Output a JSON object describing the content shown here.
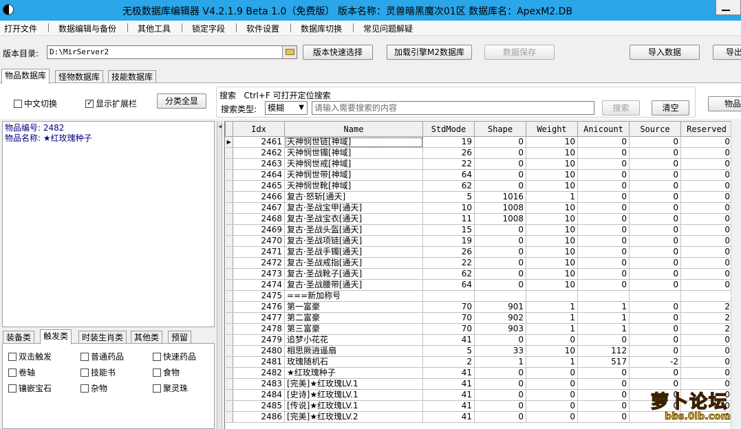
{
  "window": {
    "title": "无极数据库编辑器 V4.2.1.9    Beta 1.0（免费版）    版本名称：灵兽暗黑魔次01区    数据库名：ApexM2.DB"
  },
  "menu": [
    "打开文件",
    "数据编辑与备份",
    "其他工具",
    "锁定字段",
    "软件设置",
    "数据库切换",
    "常见问题解疑"
  ],
  "toolbar": {
    "dir_label": "版本目录:",
    "dir_value": "D:\\MirServer2",
    "quick_select": "版本快速选择",
    "load_engine": "加载引擎M2数据库",
    "save_data": "数据保存",
    "import_data": "导入数据",
    "export_data": "导出"
  },
  "main_tabs": [
    "物品数据库",
    "怪物数据库",
    "技能数据库"
  ],
  "filter": {
    "chinese_switch": "中文切换",
    "show_ext": "显示扩展栏",
    "show_all": "分类全显",
    "search_title": "搜索   Ctrl+F 可打开定位搜索",
    "search_type_label": "搜索类型:",
    "search_type_value": "模糊",
    "search_placeholder": "请输入需要搜索的内容",
    "search_button": "搜索",
    "clear_button": "清空",
    "right_button": "物品"
  },
  "info": {
    "item_id": "物品编号: 2482",
    "item_name": "物品名称: ★红玫瑰种子"
  },
  "category_tabs": [
    "装备类",
    "触发类",
    "时装生肖类",
    "其他类",
    "预留"
  ],
  "category_checks": [
    [
      "双击触发",
      "普通药品",
      "快速药品"
    ],
    [
      "卷轴",
      "技能书",
      "食物"
    ],
    [
      "镶嵌宝石",
      "杂物",
      "聚灵珠"
    ]
  ],
  "grid": {
    "columns": [
      "Idx",
      "Name",
      "StdMode",
      "Shape",
      "Weight",
      "Anicount",
      "Source",
      "Reserved"
    ],
    "rows": [
      [
        "2461",
        "天神悯世链[神域]",
        "19",
        "0",
        "10",
        "0",
        "0",
        "0"
      ],
      [
        "2462",
        "天神悯世镯[神域]",
        "26",
        "0",
        "10",
        "0",
        "0",
        "0"
      ],
      [
        "2463",
        "天神悯世戒[神域]",
        "22",
        "0",
        "10",
        "0",
        "0",
        "0"
      ],
      [
        "2464",
        "天神悯世带[神域]",
        "64",
        "0",
        "10",
        "0",
        "0",
        "0"
      ],
      [
        "2465",
        "天神悯世靴[神域]",
        "62",
        "0",
        "10",
        "0",
        "0",
        "0"
      ],
      [
        "2466",
        "复古·怒斩[通天]",
        "5",
        "1016",
        "1",
        "0",
        "0",
        "0"
      ],
      [
        "2467",
        "复古·圣战宝甲[通天]",
        "10",
        "1008",
        "10",
        "0",
        "0",
        "0"
      ],
      [
        "2468",
        "复古·圣战宝衣[通天]",
        "11",
        "1008",
        "10",
        "0",
        "0",
        "0"
      ],
      [
        "2469",
        "复古·圣战头盔[通天]",
        "15",
        "0",
        "10",
        "0",
        "0",
        "0"
      ],
      [
        "2470",
        "复古·圣战项链[通天]",
        "19",
        "0",
        "10",
        "0",
        "0",
        "0"
      ],
      [
        "2471",
        "复古·圣战手镯[通天]",
        "26",
        "0",
        "10",
        "0",
        "0",
        "0"
      ],
      [
        "2472",
        "复古·圣战戒指[通天]",
        "22",
        "0",
        "10",
        "0",
        "0",
        "0"
      ],
      [
        "2473",
        "复古·圣战靴子[通天]",
        "62",
        "0",
        "10",
        "0",
        "0",
        "0"
      ],
      [
        "2474",
        "复古·圣战腰带[通天]",
        "64",
        "0",
        "10",
        "0",
        "0",
        "0"
      ],
      [
        "2475",
        "===新加称号",
        "",
        "",
        "",
        "",
        "",
        ""
      ],
      [
        "2476",
        "第一富豪",
        "70",
        "901",
        "1",
        "1",
        "0",
        "2"
      ],
      [
        "2477",
        "第二富豪",
        "70",
        "902",
        "1",
        "1",
        "0",
        "2"
      ],
      [
        "2478",
        "第三富豪",
        "70",
        "903",
        "1",
        "1",
        "0",
        "2"
      ],
      [
        "2479",
        "追梦小花花",
        "41",
        "0",
        "0",
        "0",
        "0",
        "0"
      ],
      [
        "2480",
        "相思厥逍遥扇",
        "5",
        "33",
        "10",
        "112",
        "0",
        "0"
      ],
      [
        "2481",
        "玫瑰随机石",
        "2",
        "1",
        "1",
        "517",
        "-2",
        "0"
      ],
      [
        "2482",
        "★红玫瑰种子",
        "41",
        "0",
        "0",
        "0",
        "0",
        "0"
      ],
      [
        "2483",
        "[完美]★红玫瑰LV.1",
        "41",
        "0",
        "0",
        "0",
        "0",
        "0"
      ],
      [
        "2484",
        "[史诗]★红玫瑰LV.1",
        "41",
        "0",
        "0",
        "0",
        "0",
        "0"
      ],
      [
        "2485",
        "[传说]★红玫瑰LV.1",
        "41",
        "0",
        "0",
        "0",
        "0",
        "0"
      ],
      [
        "2486",
        "[完美]★红玫瑰LV.2",
        "41",
        "0",
        "0",
        "0",
        "0",
        "0"
      ]
    ]
  },
  "watermark": {
    "main": "萝卜论坛",
    "sub": "bbs.0lb.com"
  }
}
